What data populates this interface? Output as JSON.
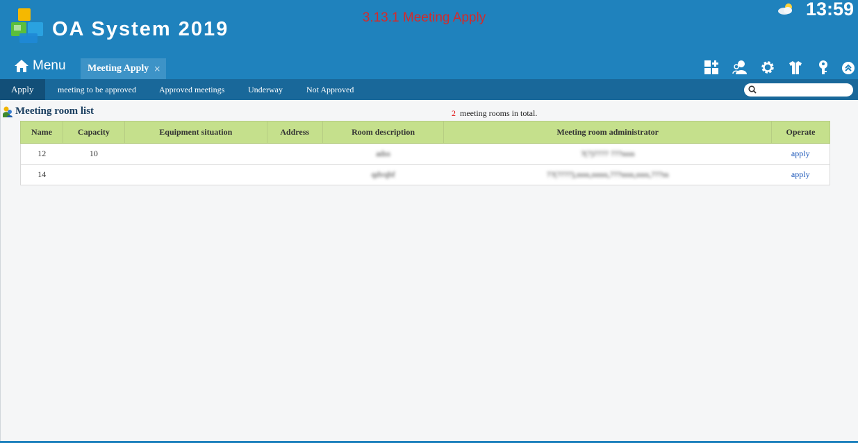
{
  "header": {
    "app_title": "OA System 2019",
    "caption": "3.13.1 Meeting Apply",
    "clock": "13:59",
    "menu_label": "Menu",
    "active_tab": "Meeting Apply",
    "tab_close": "×"
  },
  "subnav": {
    "items": [
      "Apply",
      "meeting to be approved",
      "Approved meetings",
      "Underway",
      "Not Approved"
    ],
    "search_placeholder": ""
  },
  "content": {
    "section_title": "Meeting room list",
    "count": "2",
    "count_suffix": "meeting rooms in total.",
    "columns": [
      "Name",
      "Capacity",
      "Equipment situation",
      "Address",
      "Room description",
      "Meeting room administrator",
      "Operate"
    ],
    "rows": [
      {
        "name": "12",
        "capacity": "10",
        "equipment": "",
        "address": "",
        "description": "adss",
        "administrator": "?(?)???? ???ssss",
        "operate": "apply"
      },
      {
        "name": "14",
        "capacity": "",
        "equipment": "",
        "address": "",
        "description": "qdvqbf",
        "administrator": "??(????),ssss,sssss,???ssss,ssss,???ss",
        "operate": "apply"
      }
    ]
  },
  "colors": {
    "header_bg": "#1f82bd",
    "subnav_bg": "#19689a",
    "table_header_bg": "#c5e08c",
    "caption_red": "#d42a2a",
    "link_blue": "#1a56b8"
  },
  "icons": [
    "logo-icon",
    "weather-icon",
    "home-icon",
    "grid-add-icon",
    "users-icon",
    "gear-icon",
    "shirt-icon",
    "key-icon",
    "chevron-up-icon",
    "search-icon",
    "section-icon"
  ]
}
